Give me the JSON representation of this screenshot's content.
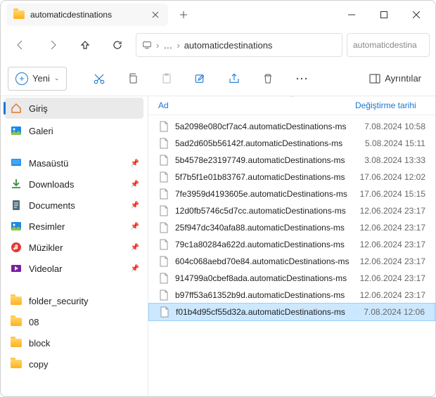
{
  "window": {
    "tab_title": "automaticdestinations"
  },
  "breadcrumb": {
    "current": "automaticdestinations",
    "search_placeholder": "automaticdestina"
  },
  "toolbar": {
    "new_label": "Yeni",
    "details_label": "Ayrıntılar"
  },
  "sidebar": {
    "home": "Giriş",
    "gallery": "Galeri",
    "desktop": "Masaüstü",
    "downloads": "Downloads",
    "documents": "Documents",
    "pictures": "Resimler",
    "music": "Müzikler",
    "videos": "Videolar",
    "folders": [
      "folder_security",
      "08",
      "block",
      "copy"
    ]
  },
  "columns": {
    "name": "Ad",
    "date": "Değiştirme tarihi"
  },
  "files": [
    {
      "name": "5a2098e080cf7ac4.automaticDestinations-ms",
      "date": "7.08.2024 10:58",
      "selected": false
    },
    {
      "name": "5ad2d605b56142f.automaticDestinations-ms",
      "date": "5.08.2024 15:11",
      "selected": false
    },
    {
      "name": "5b4578e23197749.automaticDestinations-ms",
      "date": "3.08.2024 13:33",
      "selected": false
    },
    {
      "name": "5f7b5f1e01b83767.automaticDestinations-ms",
      "date": "17.06.2024 12:02",
      "selected": false
    },
    {
      "name": "7fe3959d4193605e.automaticDestinations-ms",
      "date": "17.06.2024 15:15",
      "selected": false
    },
    {
      "name": "12d0fb5746c5d7cc.automaticDestinations-ms",
      "date": "12.06.2024 23:17",
      "selected": false
    },
    {
      "name": "25f947dc340afa88.automaticDestinations-ms",
      "date": "12.06.2024 23:17",
      "selected": false
    },
    {
      "name": "79c1a80284a622d.automaticDestinations-ms",
      "date": "12.06.2024 23:17",
      "selected": false
    },
    {
      "name": "604c068aebd70e84.automaticDestinations-ms",
      "date": "12.06.2024 23:17",
      "selected": false
    },
    {
      "name": "914799a0cbef8ada.automaticDestinations-ms",
      "date": "12.06.2024 23:17",
      "selected": false
    },
    {
      "name": "b97ff53a61352b9d.automaticDestinations-ms",
      "date": "12.06.2024 23:17",
      "selected": false
    },
    {
      "name": "f01b4d95cf55d32a.automaticDestinations-ms",
      "date": "7.08.2024 12:06",
      "selected": true
    }
  ]
}
